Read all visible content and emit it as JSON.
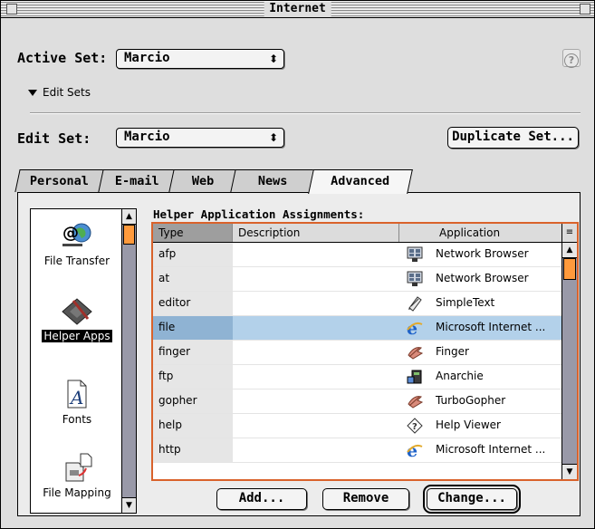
{
  "window": {
    "title": "Internet"
  },
  "active_set": {
    "label": "Active Set:",
    "value": "Marcio"
  },
  "edit_sets_toggle": {
    "label": "Edit Sets"
  },
  "edit_set": {
    "label": "Edit Set:",
    "value": "Marcio"
  },
  "buttons": {
    "duplicate_set": "Duplicate Set...",
    "add": "Add...",
    "remove": "Remove",
    "change": "Change..."
  },
  "tabs": [
    {
      "label": "Personal",
      "active": false
    },
    {
      "label": "E-mail",
      "active": false
    },
    {
      "label": "Web",
      "active": false
    },
    {
      "label": "News",
      "active": false
    },
    {
      "label": "Advanced",
      "active": true
    }
  ],
  "sidebar": {
    "items": [
      {
        "label": "File Transfer",
        "icon": "file-transfer-icon",
        "selected": false
      },
      {
        "label": "Helper Apps",
        "icon": "helper-apps-icon",
        "selected": true
      },
      {
        "label": "Fonts",
        "icon": "fonts-icon",
        "selected": false
      },
      {
        "label": "File Mapping",
        "icon": "file-mapping-icon",
        "selected": false
      }
    ]
  },
  "helper_table": {
    "title": "Helper Application Assignments:",
    "columns": [
      "Type",
      "Description",
      "Application"
    ],
    "rows": [
      {
        "type": "afp",
        "description": "",
        "application": "Network Browser",
        "icon": "network-browser-icon",
        "selected": false
      },
      {
        "type": "at",
        "description": "",
        "application": "Network Browser",
        "icon": "network-browser-icon",
        "selected": false
      },
      {
        "type": "editor",
        "description": "",
        "application": "SimpleText",
        "icon": "simpletext-icon",
        "selected": false
      },
      {
        "type": "file",
        "description": "",
        "application": "Microsoft Internet ...",
        "icon": "internet-explorer-icon",
        "selected": true
      },
      {
        "type": "finger",
        "description": "",
        "application": "Finger",
        "icon": "finger-icon",
        "selected": false
      },
      {
        "type": "ftp",
        "description": "",
        "application": "Anarchie",
        "icon": "anarchie-icon",
        "selected": false
      },
      {
        "type": "gopher",
        "description": "",
        "application": "TurboGopher",
        "icon": "turbogopher-icon",
        "selected": false
      },
      {
        "type": "help",
        "description": "",
        "application": "Help Viewer",
        "icon": "help-viewer-icon",
        "selected": false
      },
      {
        "type": "http",
        "description": "",
        "application": "Microsoft Internet ...",
        "icon": "internet-explorer-icon",
        "selected": false
      }
    ]
  },
  "colors": {
    "accent": "#d9622b",
    "scroll_thumb": "#ff9a3c",
    "selection": "#b3d1ea"
  }
}
